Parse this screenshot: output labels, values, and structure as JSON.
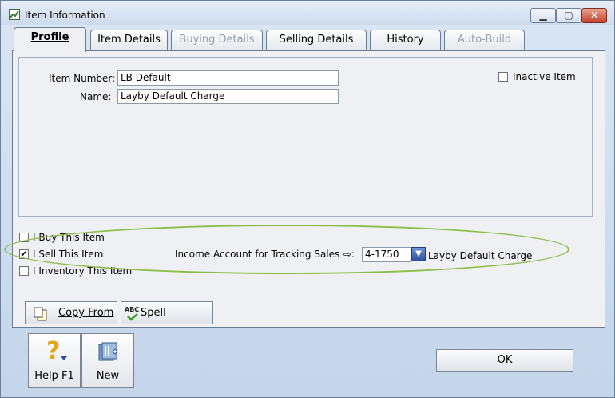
{
  "window": {
    "title": "Item Information",
    "min_glyph": "▁",
    "max_glyph": "▢",
    "close_glyph": "✕"
  },
  "tabs": [
    {
      "label": "Profile",
      "state": "active"
    },
    {
      "label": "Item Details",
      "state": "normal"
    },
    {
      "label": "Buying Details",
      "state": "disabled"
    },
    {
      "label": "Selling Details",
      "state": "normal"
    },
    {
      "label": "History",
      "state": "normal"
    },
    {
      "label": "Auto-Build",
      "state": "disabled"
    }
  ],
  "profile": {
    "item_number_label": "Item Number:",
    "item_number_value": "LB Default",
    "name_label": "Name:",
    "name_value": "Layby Default Charge",
    "inactive_label": "Inactive Item",
    "inactive_checked": false
  },
  "options": {
    "buy_label": "I Buy This Item",
    "buy_checked": false,
    "sell_label": "I Sell This Item",
    "sell_checked": true,
    "inventory_label": "I Inventory This Item",
    "inventory_checked": false,
    "income_account_label": "Income Account for Tracking Sales",
    "income_account_arrow": "⇨:",
    "income_account_value": "4-1750",
    "income_account_name": "Layby Default Charge"
  },
  "buttons": {
    "copy_from": "Copy From",
    "spell": "Spell",
    "help": "Help F1",
    "new": "New",
    "ok": "OK"
  },
  "colors": {
    "highlight_ellipse": "#8cbd46",
    "lookup_blue": "#2b4f9e"
  },
  "icons": {
    "check_glyph": "✔",
    "lookup_glyph": "▼",
    "help_glyph": "?",
    "spell_glyph": "ABC"
  }
}
